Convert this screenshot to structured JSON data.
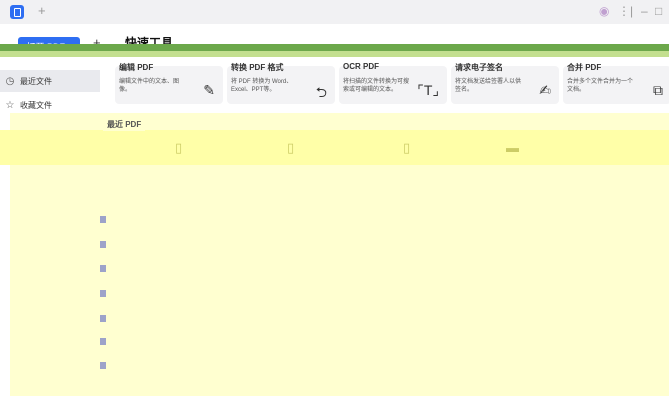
{
  "titlebar": {
    "new_tab": "+",
    "icons": [
      "settings-icon",
      "more-icon",
      "minimize-icon",
      "maximize-icon"
    ]
  },
  "sidebar": {
    "open_button": "打开 PDF...",
    "more_label": "+",
    "items": [
      {
        "label": "最近文件",
        "icon": "clock-icon"
      },
      {
        "label": "收藏文件",
        "icon": "star-icon"
      }
    ]
  },
  "main": {
    "title": "快速工具",
    "cards": [
      {
        "title": "编辑 PDF",
        "desc": "编辑文件中的文本、图像。",
        "icon": "edit-icon"
      },
      {
        "title": "转换 PDF 格式",
        "desc": "将 PDF 转换为 Word、Excel、PPT等。",
        "icon": "convert-icon"
      },
      {
        "title": "OCR PDF",
        "desc": "将扫描的文件转换为可搜索或可编辑的文本。",
        "icon": "ocr-icon"
      },
      {
        "title": "请求电子签名",
        "desc": "将文档发送给签署人以供签名。",
        "icon": "sign-icon"
      },
      {
        "title": "合并 PDF",
        "desc": "合并多个文件合并为一个文档。",
        "icon": "merge-icon"
      }
    ],
    "recent_label": "最近 PDF",
    "colors": {
      "accent": "#2e6ef2",
      "green_dark": "#6ca84b",
      "green_light": "#c3df8f",
      "yellow": "#ffffd0"
    }
  }
}
